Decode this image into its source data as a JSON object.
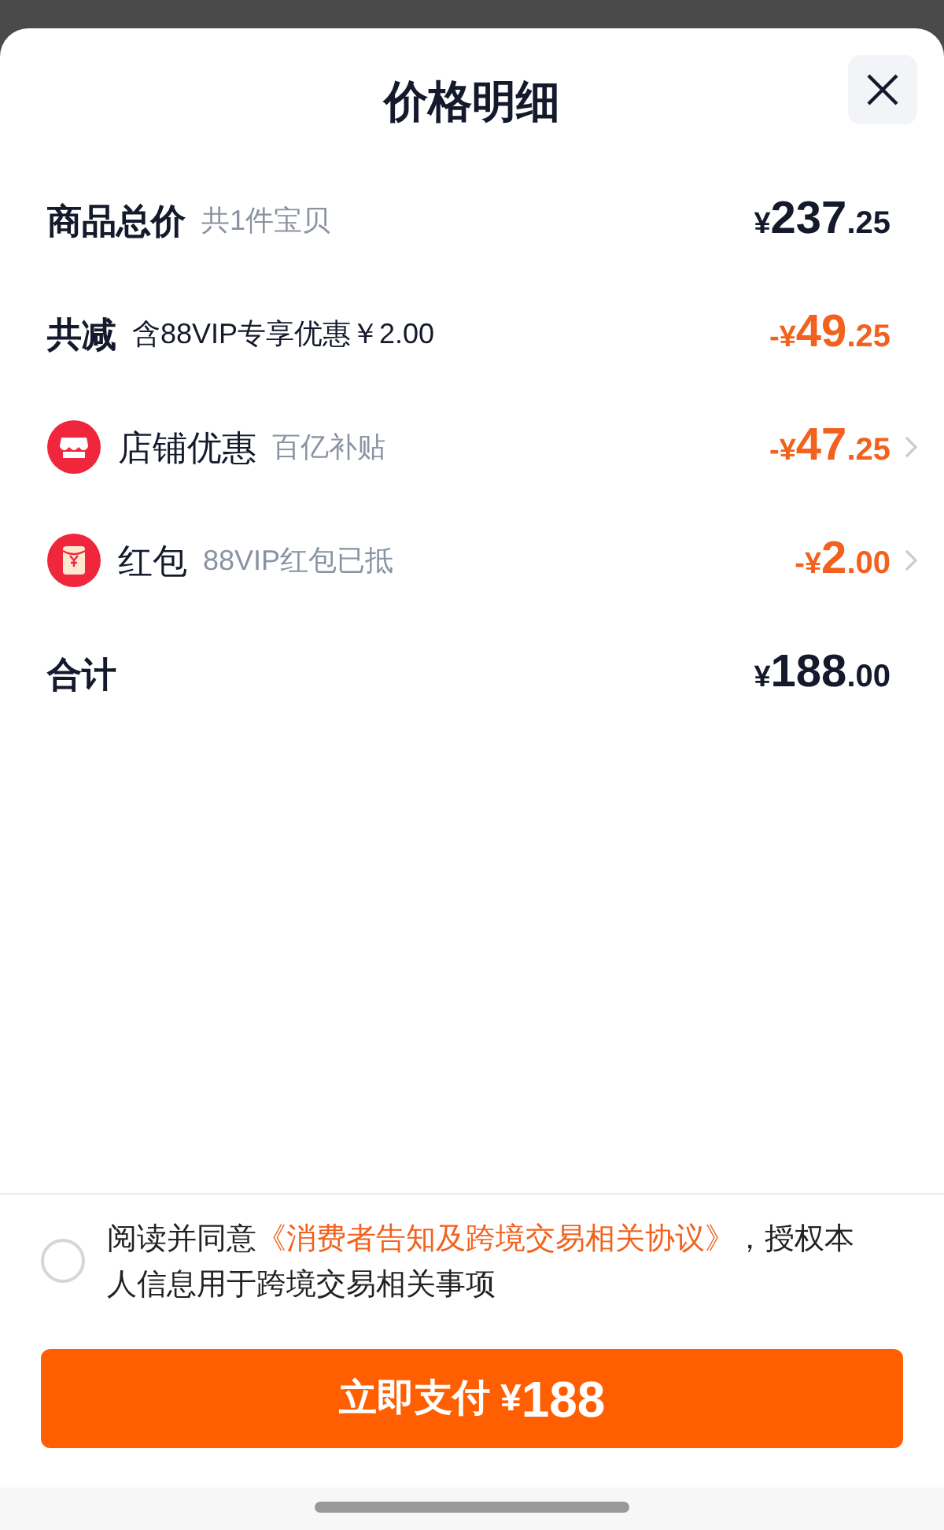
{
  "sheet": {
    "title": "价格明细",
    "rows": [
      {
        "kind": "summary",
        "label": "商品总价",
        "note": "共1件宝贝",
        "note_muted": true,
        "discount": false,
        "amount": {
          "prefix": "¥",
          "integer": "237",
          "decimal": ".25"
        },
        "has_arrow": false
      },
      {
        "kind": "summary",
        "label": "共减",
        "note": "含88VIP专享优惠￥2.00",
        "note_muted": false,
        "discount": true,
        "amount": {
          "prefix": "-¥",
          "integer": "49",
          "decimal": ".25"
        },
        "has_arrow": false
      },
      {
        "kind": "store",
        "label": "店铺优惠",
        "note": "百亿补贴",
        "note_muted": true,
        "discount": true,
        "amount": {
          "prefix": "-¥",
          "integer": "47",
          "decimal": ".25"
        },
        "has_arrow": true
      },
      {
        "kind": "envelope",
        "label": "红包",
        "note": "88VIP红包已抵",
        "note_muted": true,
        "discount": true,
        "amount": {
          "prefix": "-¥",
          "integer": "2",
          "decimal": ".00"
        },
        "has_arrow": true
      },
      {
        "kind": "summary",
        "label": "合计",
        "discount": false,
        "amount": {
          "prefix": "¥",
          "integer": "188",
          "decimal": ".00"
        },
        "has_arrow": false
      }
    ]
  },
  "agreement": {
    "checked": false,
    "prefix": "阅读并同意",
    "link": "《消费者告知及跨境交易相关协议》",
    "suffix": "，授权本人信息用于跨境交易相关事项"
  },
  "pay_button": {
    "label": "立即支付",
    "prefix": "¥",
    "amount": "188"
  }
}
